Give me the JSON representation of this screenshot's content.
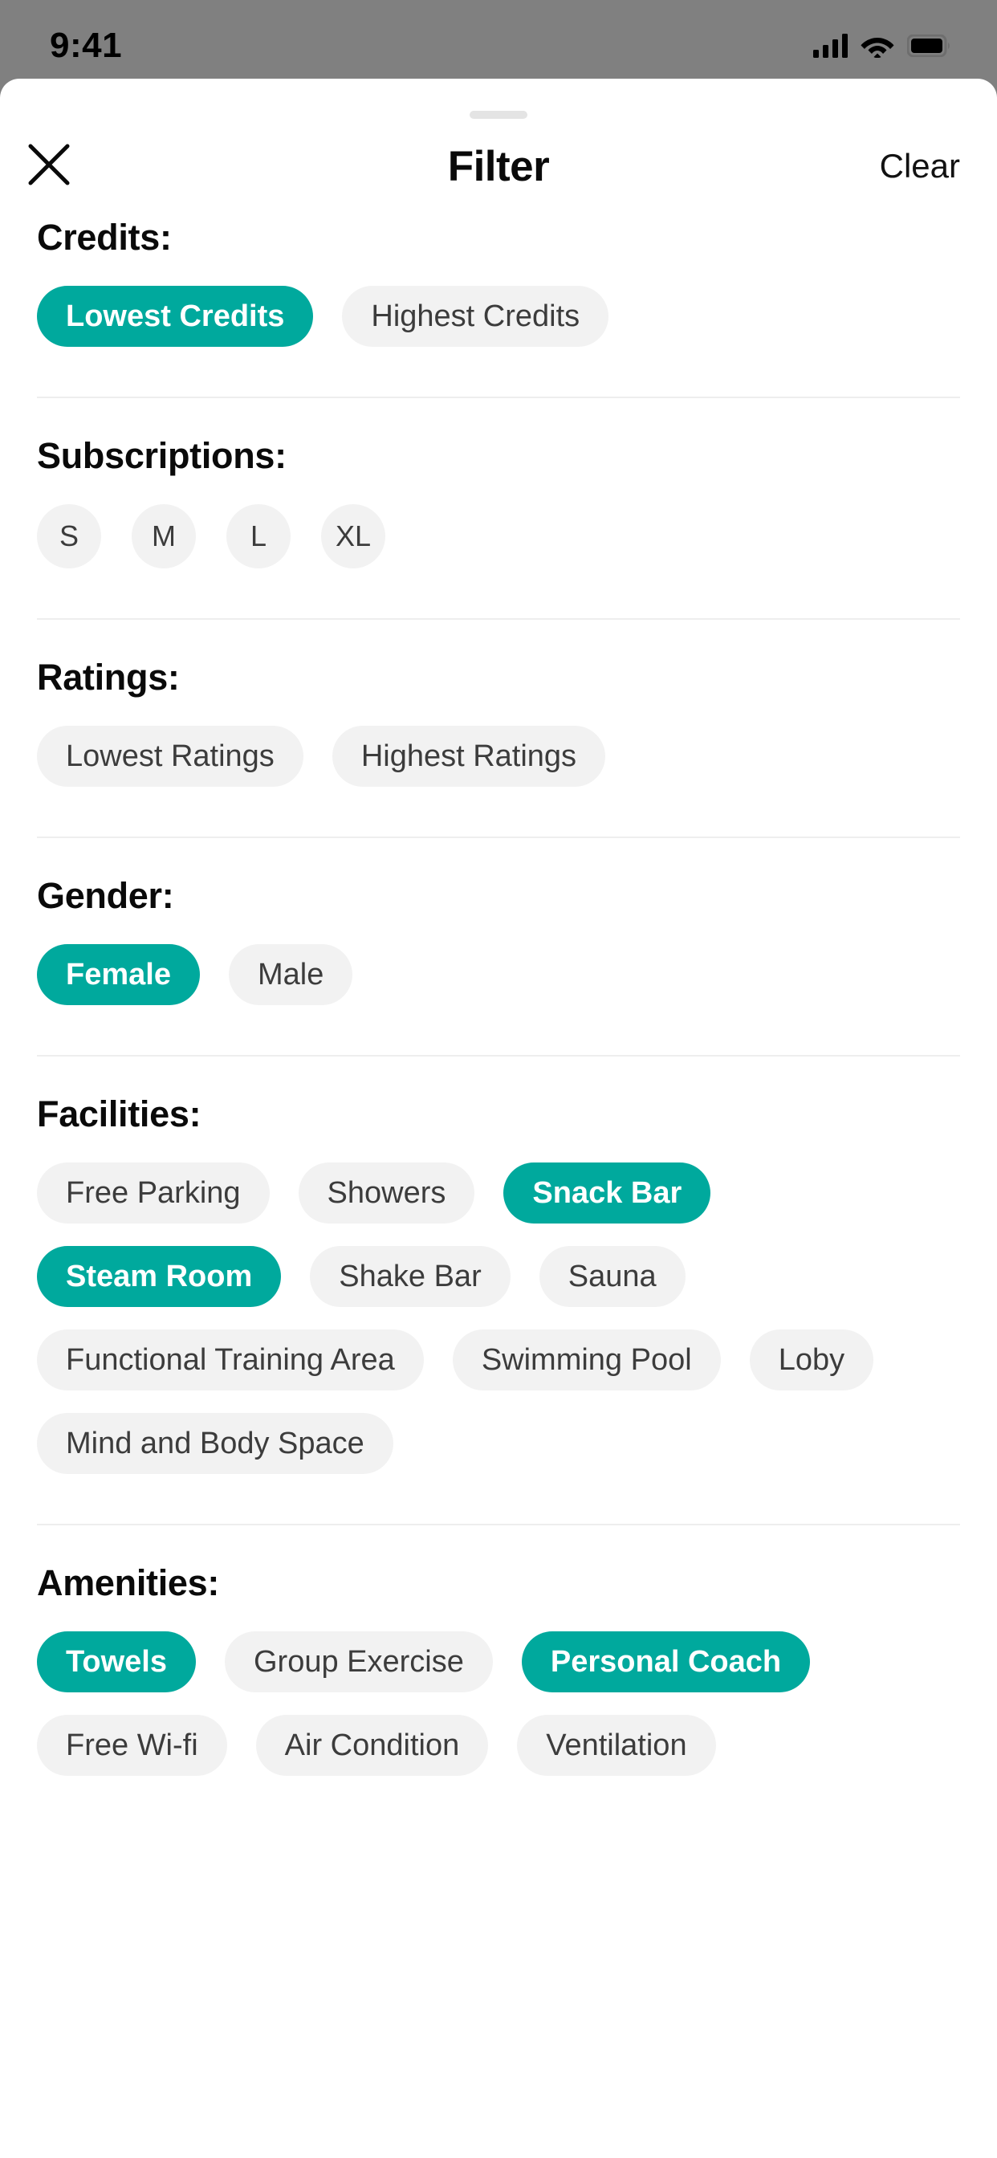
{
  "status_bar": {
    "time": "9:41",
    "signal_icon": "signal-bars-icon",
    "wifi_icon": "wifi-icon",
    "battery_icon": "battery-full-icon"
  },
  "header": {
    "close_icon": "close-x-icon",
    "title": "Filter",
    "clear_label": "Clear",
    "drag_handle": "drag-handle"
  },
  "colors": {
    "accent": "#00a99d",
    "chip_unselected_bg": "#f2f2f2",
    "chip_unselected_text": "#3c3c3c",
    "chip_selected_text": "#ffffff",
    "backdrop": "#808080",
    "sheet_bg": "#ffffff",
    "divider": "#eeeeee"
  },
  "sections": [
    {
      "title": "Credits:",
      "shape": "pill",
      "options": [
        {
          "label": "Lowest Credits",
          "selected": true
        },
        {
          "label": "Highest Credits",
          "selected": false
        }
      ]
    },
    {
      "title": "Subscriptions:",
      "shape": "circle",
      "options": [
        {
          "label": "S",
          "selected": false
        },
        {
          "label": "M",
          "selected": false
        },
        {
          "label": "L",
          "selected": false
        },
        {
          "label": "XL",
          "selected": false
        }
      ]
    },
    {
      "title": "Ratings:",
      "shape": "pill",
      "options": [
        {
          "label": "Lowest Ratings",
          "selected": false
        },
        {
          "label": "Highest Ratings",
          "selected": false
        }
      ]
    },
    {
      "title": "Gender:",
      "shape": "pill",
      "options": [
        {
          "label": "Female",
          "selected": true
        },
        {
          "label": "Male",
          "selected": false
        }
      ]
    },
    {
      "title": "Facilities:",
      "shape": "pill",
      "options": [
        {
          "label": "Free Parking",
          "selected": false
        },
        {
          "label": "Showers",
          "selected": false
        },
        {
          "label": "Snack Bar",
          "selected": true
        },
        {
          "label": "Steam Room",
          "selected": true
        },
        {
          "label": "Shake Bar",
          "selected": false
        },
        {
          "label": "Sauna",
          "selected": false
        },
        {
          "label": "Functional Training Area",
          "selected": false
        },
        {
          "label": "Swimming Pool",
          "selected": false
        },
        {
          "label": "Loby",
          "selected": false
        },
        {
          "label": "Mind and Body Space",
          "selected": false
        }
      ]
    },
    {
      "title": "Amenities:",
      "shape": "pill",
      "options": [
        {
          "label": "Towels",
          "selected": true
        },
        {
          "label": "Group Exercise",
          "selected": false
        },
        {
          "label": "Personal Coach",
          "selected": true
        },
        {
          "label": "Free Wi-fi",
          "selected": false
        },
        {
          "label": "Air Condition",
          "selected": false
        },
        {
          "label": "Ventilation",
          "selected": false
        }
      ]
    }
  ]
}
